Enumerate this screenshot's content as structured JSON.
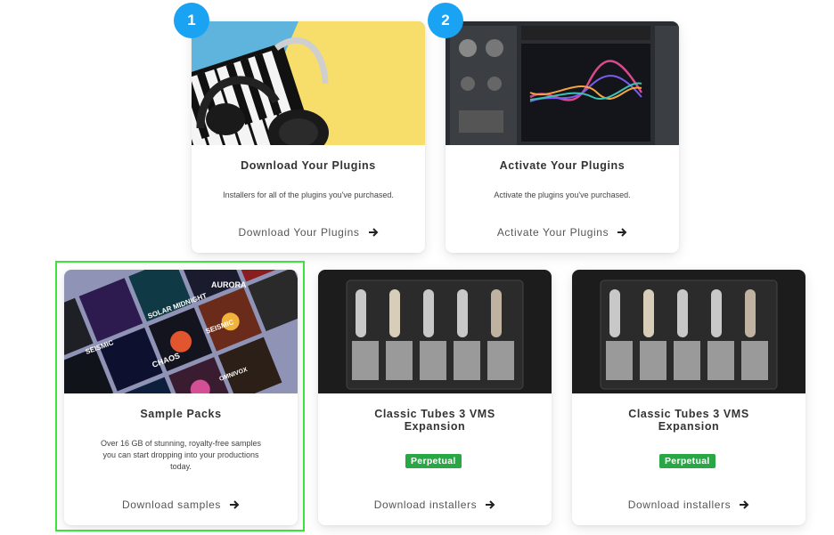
{
  "steps": [
    "1",
    "2"
  ],
  "cards": {
    "download": {
      "title": "Download Your Plugins",
      "desc": "Installers for all of the plugins you've purchased.",
      "link": "Download Your Plugins"
    },
    "activate": {
      "title": "Activate Your Plugins",
      "desc": "Activate the plugins you've purchased.",
      "link": "Activate Your Plugins"
    },
    "samples": {
      "title": "Sample Packs",
      "desc": "Over 16 GB of stunning, royalty-free samples you can start dropping into your productions today.",
      "link": "Download samples",
      "cover_texts": [
        "AURORA",
        "SOLAR MIDNIGHT",
        "SEISMIC",
        "SEISMIC",
        "CHAOS",
        "OMNIVOX"
      ]
    },
    "tubes1": {
      "title": "Classic Tubes 3 VMS Expansion",
      "badge": "Perpetual",
      "link": "Download installers"
    },
    "tubes2": {
      "title": "Classic Tubes 3 VMS Expansion",
      "badge": "Perpetual",
      "link": "Download installers"
    }
  },
  "colors": {
    "step_badge": "#1aa3f2",
    "perpetual_badge": "#2aa745",
    "highlight_border": "#3ee23e"
  },
  "icons": {
    "link_arrow": "arrow-right-icon"
  }
}
